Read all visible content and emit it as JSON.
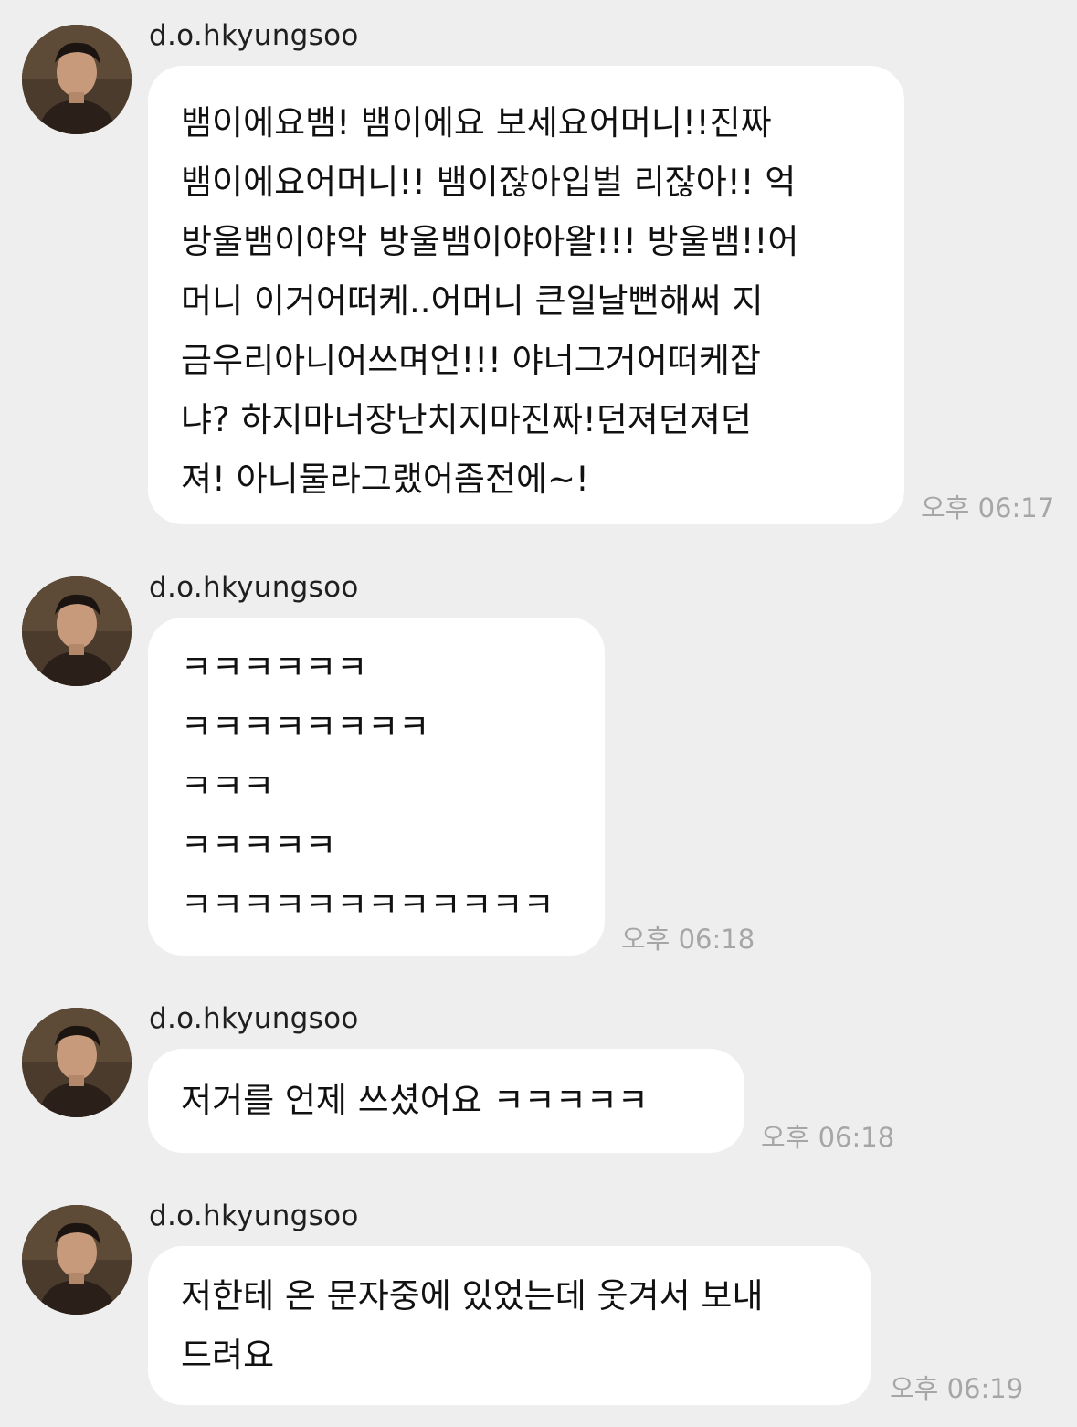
{
  "messages": [
    {
      "sender": "d.o.hkyungsoo",
      "text": "뱀이에요뱀! 뱀이에요 보세요어머니!!진짜\n뱀이에요어머니!! 뱀이잖아입벌 리잖아!! 억\n방울뱀이야악 방울뱀이야아왈!!! 방울뱀!!어\n머니 이거어떠케..어머니 큰일날뻔해써 지\n금우리아니어쓰며언!!! 야너그거어떠케잡\n냐? 하지마너장난치지마진짜!던져던져던\n져! 아니물라그랬어좀전에~!",
      "time": "오후 06:17"
    },
    {
      "sender": "d.o.hkyungsoo",
      "text": "ㅋㅋㅋㅋㅋㅋ\nㅋㅋㅋㅋㅋㅋㅋㅋ\nㅋㅋㅋ\nㅋㅋㅋㅋㅋ\nㅋㅋㅋㅋㅋㅋㅋㅋㅋㅋㅋㅋ",
      "time": "오후 06:18"
    },
    {
      "sender": "d.o.hkyungsoo",
      "text": "저거를 언제 쓰셨어요 ㅋㅋㅋㅋㅋ",
      "time": "오후 06:18"
    },
    {
      "sender": "d.o.hkyungsoo",
      "text": "저한테 온 문자중에 있었는데 웃겨서 보내\n드려요",
      "time": "오후 06:19"
    }
  ]
}
